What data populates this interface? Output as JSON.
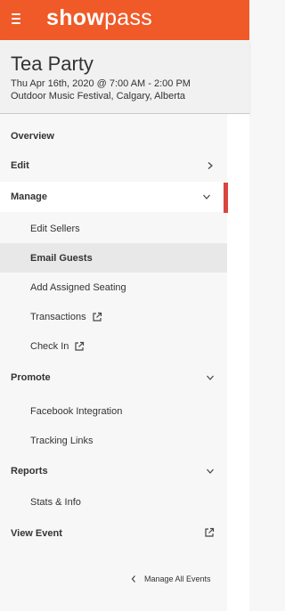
{
  "app": {
    "logo_bold": "show",
    "logo_light": "pass",
    "brand_color": "#f05a28"
  },
  "event": {
    "title": "Tea Party",
    "datetime": "Thu Apr 16th, 2020 @ 7:00 AM - 2:00 PM",
    "location": "Outdoor Music Festival, Calgary, Alberta"
  },
  "nav": {
    "overview": "Overview",
    "edit": "Edit",
    "manage": "Manage",
    "manage_items": [
      {
        "label": "Edit Sellers"
      },
      {
        "label": "Email Guests"
      },
      {
        "label": "Add Assigned Seating"
      },
      {
        "label": "Transactions",
        "icon": "external-link-icon"
      },
      {
        "label": "Check In",
        "icon": "external-link-icon"
      }
    ],
    "promote": "Promote",
    "promote_items": [
      {
        "label": "Facebook Integration"
      },
      {
        "label": "Tracking Links"
      }
    ],
    "reports": "Reports",
    "reports_items": [
      {
        "label": "Stats & Info"
      }
    ],
    "view_event": "View Event",
    "manage_all": "Manage All Events",
    "active_indicator_color": "#d9443f"
  }
}
